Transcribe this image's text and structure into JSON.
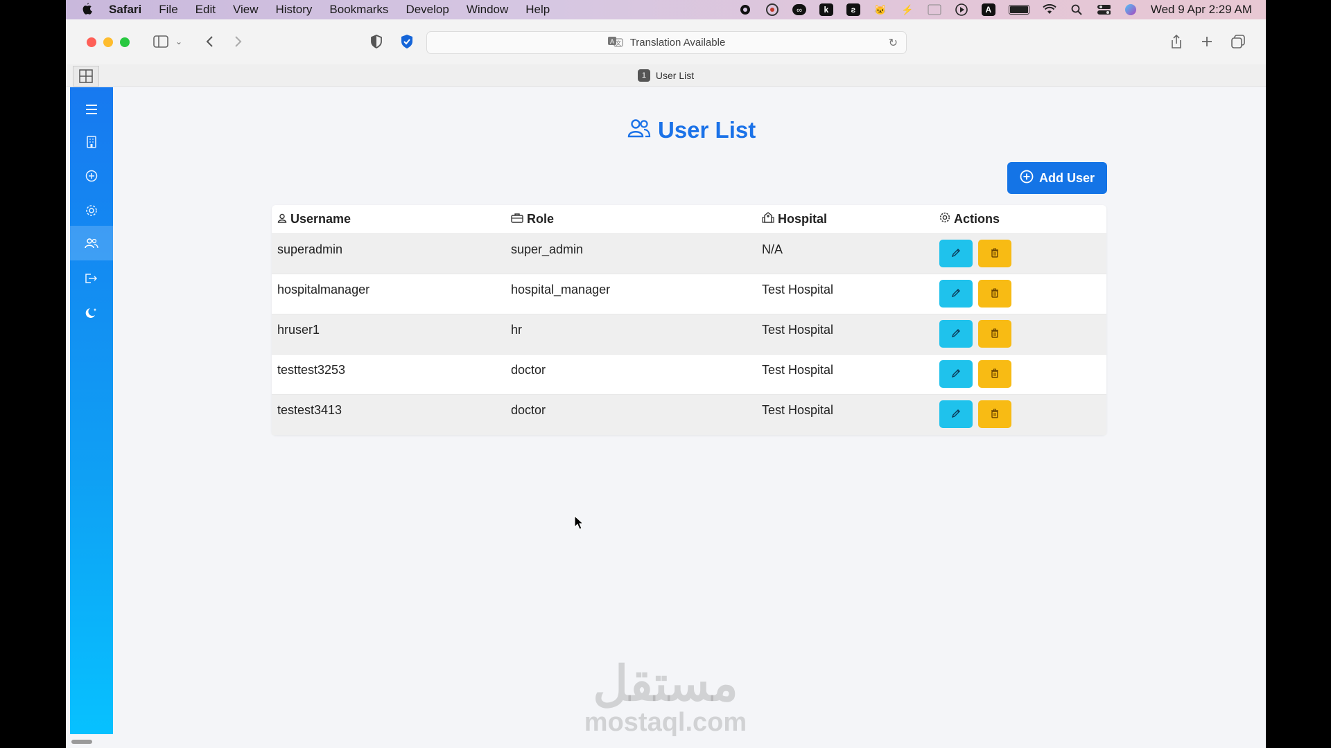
{
  "menubar": {
    "app": "Safari",
    "items": [
      "File",
      "Edit",
      "View",
      "History",
      "Bookmarks",
      "Develop",
      "Window",
      "Help"
    ],
    "status_icons": [
      "record-icon",
      "grammarly-icon",
      "infinity-icon",
      "k-icon",
      "stripe-icon",
      "cat-icon",
      "bolt-icon",
      "window-icon",
      "play-icon",
      "keyboard-icon",
      "battery-icon",
      "wifi-icon",
      "search-icon",
      "control-center-icon",
      "siri-icon"
    ],
    "keyboard_label": "A",
    "clock": "Wed 9 Apr  2:29 AM"
  },
  "browser": {
    "address_text": "Translation Available",
    "tab_number": "1",
    "tab_title": "User List"
  },
  "sidebar": {
    "items": [
      "menu-icon",
      "hospital-icon",
      "add-circle-icon",
      "settings-icon",
      "users-icon",
      "logout-icon",
      "moon-icon"
    ],
    "active_index": 4
  },
  "page": {
    "title": "User List",
    "add_button": "Add User",
    "columns": [
      "Username",
      "Role",
      "Hospital",
      "Actions"
    ],
    "rows": [
      {
        "username": "superadmin",
        "role": "super_admin",
        "hospital": "N/A"
      },
      {
        "username": "hospitalmanager",
        "role": "hospital_manager",
        "hospital": "Test Hospital"
      },
      {
        "username": "hruser1",
        "role": "hr",
        "hospital": "Test Hospital"
      },
      {
        "username": "testtest3253",
        "role": "doctor",
        "hospital": "Test Hospital"
      },
      {
        "username": "testest3413",
        "role": "doctor",
        "hospital": "Test Hospital"
      }
    ]
  },
  "watermark": {
    "arabic": "مستقل",
    "latin": "mostaql.com"
  },
  "colors": {
    "primary": "#1474e6",
    "edit": "#1fc2ec",
    "delete": "#f8bb14",
    "sidebar_top": "#1779f0",
    "sidebar_bottom": "#07c1ff"
  }
}
